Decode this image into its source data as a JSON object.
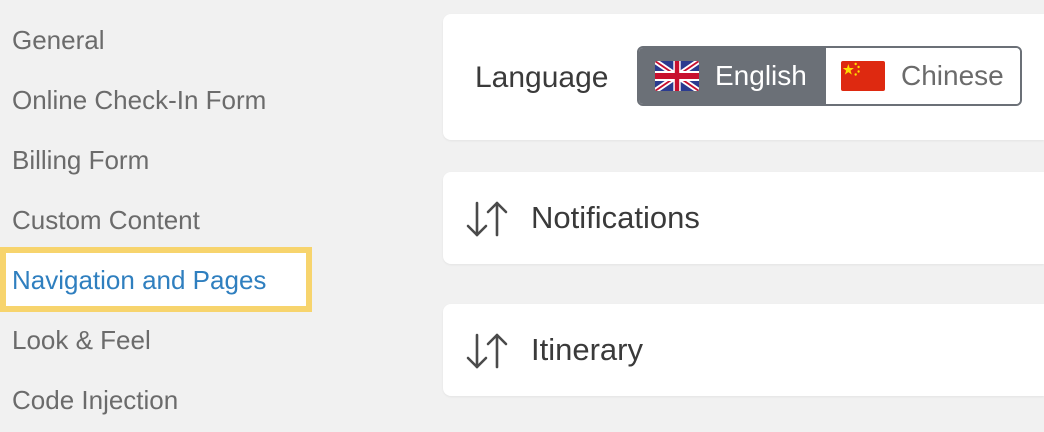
{
  "sidebar": {
    "items": [
      {
        "label": "General"
      },
      {
        "label": "Online Check-In Form"
      },
      {
        "label": "Billing Form"
      },
      {
        "label": "Custom Content"
      },
      {
        "label": "Navigation and Pages"
      },
      {
        "label": "Look & Feel"
      },
      {
        "label": "Code Injection"
      }
    ],
    "active_color": "#2f7fbf",
    "highlight_color": "#f7d46d"
  },
  "language": {
    "label": "Language",
    "options": [
      {
        "label": "English",
        "flag": "uk-flag-icon",
        "selected": true
      },
      {
        "label": "Chinese",
        "flag": "china-flag-icon",
        "selected": false
      }
    ],
    "selected_bg": "#6b7077"
  },
  "sections": [
    {
      "title": "Notifications",
      "icon": "sort-arrows-icon"
    },
    {
      "title": "Itinerary",
      "icon": "sort-arrows-icon"
    }
  ]
}
